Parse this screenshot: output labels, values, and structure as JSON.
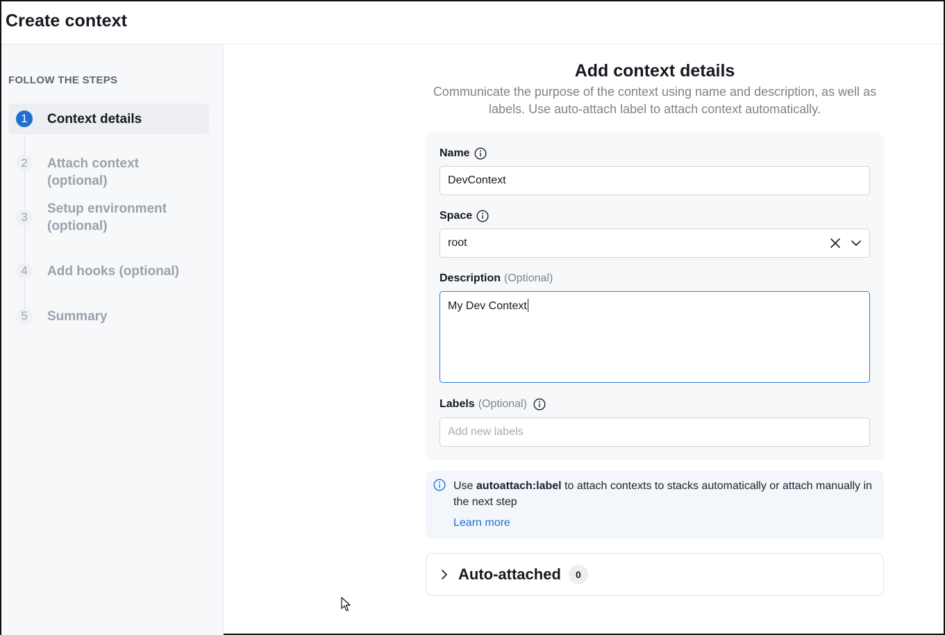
{
  "header": {
    "title": "Create context"
  },
  "sidebar": {
    "heading": "FOLLOW THE STEPS",
    "steps": [
      {
        "number": "1",
        "label": "Context details",
        "active": true
      },
      {
        "number": "2",
        "label": "Attach context (optional)",
        "active": false
      },
      {
        "number": "3",
        "label": "Setup environment (optional)",
        "active": false
      },
      {
        "number": "4",
        "label": "Add hooks (optional)",
        "active": false
      },
      {
        "number": "5",
        "label": "Summary",
        "active": false
      }
    ]
  },
  "main": {
    "title": "Add context details",
    "subtitle": "Communicate the purpose of the context using name and description, as well as labels. Use auto-attach label to attach context automatically.",
    "form": {
      "name_label": "Name",
      "name_value": "DevContext",
      "space_label": "Space",
      "space_value": "root",
      "description_label": "Description",
      "description_optional": "(Optional)",
      "description_value": "My Dev Context",
      "labels_label": "Labels",
      "labels_optional": "(Optional)",
      "labels_placeholder": "Add new labels"
    },
    "notice": {
      "prefix": "Use",
      "keyword": "autoattach:label",
      "suffix": "to attach contexts to stacks automatically or attach manually in the next step",
      "link": "Learn more"
    },
    "accordion": {
      "title": "Auto-attached",
      "count": "0"
    }
  },
  "colors": {
    "accent": "#1f6fd1",
    "focus_border": "#2f7ad8",
    "sidebar_bg": "#f7f8fa",
    "muted_text": "#9ba1ab"
  }
}
